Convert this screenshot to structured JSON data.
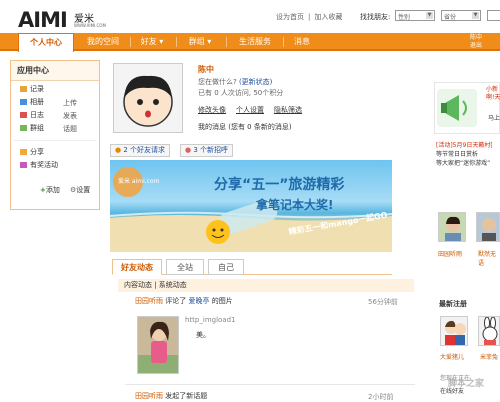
{
  "header": {
    "logo": "AIMI",
    "logo_cn": "爱米",
    "logo_url": "WWW.AIMI.COM",
    "links": [
      "设为首页",
      "|",
      "加入收藏"
    ],
    "find_friend_label": "找找朋友:",
    "gender_select": "性别",
    "age_select": "省份"
  },
  "nav": {
    "items": [
      "个人中心",
      "我的空间",
      "好友",
      "群组",
      "生活服务",
      "消息"
    ],
    "user_mini": [
      "陈中",
      "退出"
    ]
  },
  "sidebar": {
    "title": "应用中心",
    "apps": [
      {
        "label": "记录",
        "color": "#e8a33c"
      },
      {
        "label": "相册",
        "color": "#4a90d9"
      },
      {
        "label": "日志",
        "color": "#d9534f"
      },
      {
        "label": "群组",
        "color": "#7ab55c"
      }
    ],
    "apps2": [
      "上传",
      "发表",
      "话题"
    ],
    "extras": [
      "分享",
      "有奖活动"
    ],
    "add": "添加",
    "settings": "设置"
  },
  "profile": {
    "name": "陈中",
    "status_prompt": "您在做什么?",
    "status_update": "(更新状态)",
    "visits": "已有 0 人次访问, 50个积分",
    "links": [
      "修改头像",
      "个人设置",
      "隐私筛选"
    ],
    "messages": "我的消息 (您有 0 条新的消息)"
  },
  "subtabs": [
    "2 个好友请求",
    "3 个新招呼"
  ],
  "banner": {
    "headline1": "分享“五一”旅游精彩",
    "headline2": "拿笔记本大奖!",
    "slogan": "精彩五一和mango一起GO",
    "logo": "爱米 aimi.com"
  },
  "feed_tabs": [
    "好友动态",
    "全站",
    "自己"
  ],
  "feed_subbar": "内容动态  |  系统动态",
  "feed": [
    {
      "user": "田园听雨",
      "action": "评论了",
      "target": "爱晚亭",
      "suffix": "的图片",
      "time": "56分钟前",
      "img_alt": "http_imgload1",
      "text": "美。"
    },
    {
      "user": "田园听雨",
      "action": "发起了新话题",
      "time": "2小时前"
    }
  ],
  "right": {
    "ad_title": "小新\n啊!天",
    "ad_lines": [
      "马上"
    ],
    "promo": [
      "[活动]5月9日天籁村[",
      "等节常日日赏析",
      "等大家把“迷你游戏”"
    ],
    "friends": [
      "田园听雨",
      "默然无语"
    ],
    "new_reg_title": "最新注册",
    "new_users": [
      "大爱猪儿",
      "米菲兔"
    ],
    "footer_text": [
      "您现在正在",
      "在线好友"
    ]
  },
  "watermark": "脚本之家"
}
